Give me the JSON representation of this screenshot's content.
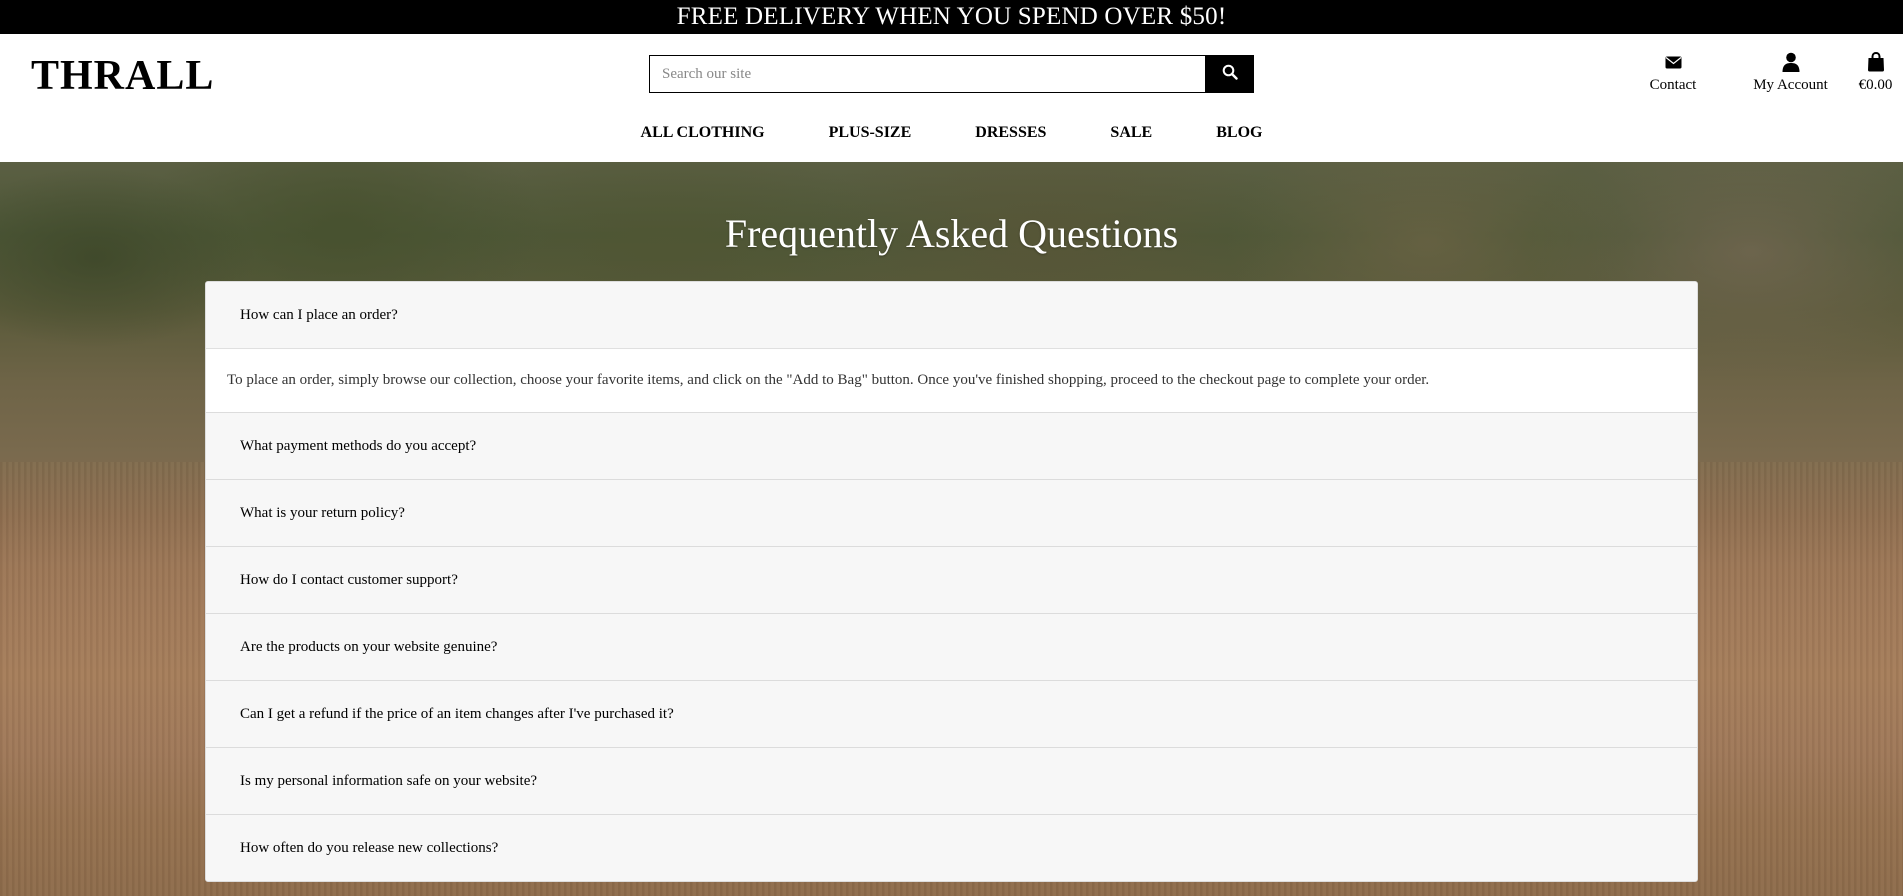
{
  "promo": {
    "text": "FREE DELIVERY WHEN YOU SPEND OVER $50!"
  },
  "header": {
    "logo": "THRALL",
    "search": {
      "placeholder": "Search our site",
      "value": ""
    },
    "links": {
      "contact": {
        "label": "Contact",
        "icon": "envelope-icon"
      },
      "account": {
        "label": "My Account",
        "icon": "user-icon"
      },
      "bag": {
        "label": "€0.00",
        "icon": "shopping-bag-icon"
      }
    }
  },
  "nav": {
    "items": [
      {
        "label": "ALL CLOTHING"
      },
      {
        "label": "PLUS-SIZE"
      },
      {
        "label": "DRESSES"
      },
      {
        "label": "SALE"
      },
      {
        "label": "BLOG"
      }
    ]
  },
  "faq": {
    "title": "Frequently Asked Questions",
    "items": [
      {
        "question": "How can I place an order?",
        "answer": "To place an order, simply browse our collection, choose your favorite items, and click on the \"Add to Bag\" button. Once you've finished shopping, proceed to the checkout page to complete your order.",
        "expanded": true
      },
      {
        "question": "What payment methods do you accept?",
        "expanded": false
      },
      {
        "question": "What is your return policy?",
        "expanded": false
      },
      {
        "question": "How do I contact customer support?",
        "expanded": false
      },
      {
        "question": "Are the products on your website genuine?",
        "expanded": false
      },
      {
        "question": "Can I get a refund if the price of an item changes after I've purchased it?",
        "expanded": false
      },
      {
        "question": "Is my personal information safe on your website?",
        "expanded": false
      },
      {
        "question": "How often do you release new collections?",
        "expanded": false
      }
    ]
  }
}
